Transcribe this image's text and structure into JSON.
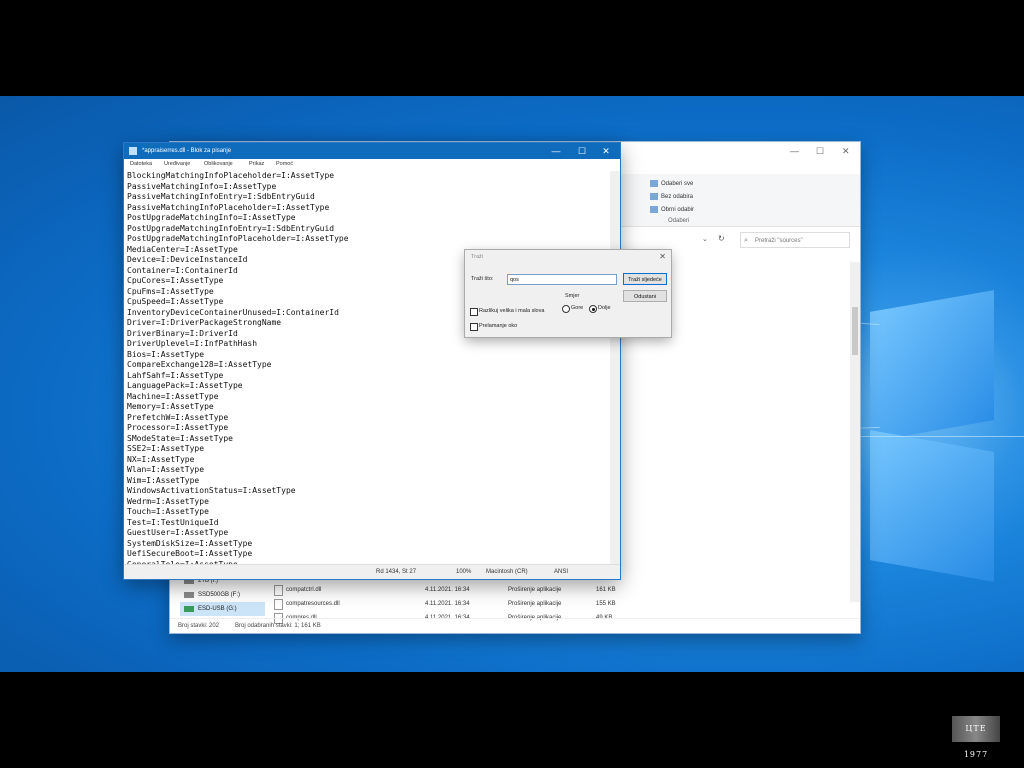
{
  "notepad": {
    "title": "*appraiserres.dll - Blok za pisanje",
    "menu": [
      "Datoteka",
      "Uređivanje",
      "Oblikovanje",
      "Prikaz",
      "Pomoć"
    ],
    "lines": [
      "BlockingMatchingInfoPlaceholder=I:AssetType",
      "PassiveMatchingInfo=I:AssetType",
      "PassiveMatchingInfoEntry=I:SdbEntryGuid",
      "PassiveMatchingInfoPlaceholder=I:AssetType",
      "PostUpgradeMatchingInfo=I:AssetType",
      "PostUpgradeMatchingInfoEntry=I:SdbEntryGuid",
      "PostUpgradeMatchingInfoPlaceholder=I:AssetType",
      "MediaCenter=I:AssetType",
      "Device=I:DeviceInstanceId",
      "Container=I:ContainerId",
      "CpuCores=I:AssetType",
      "CpuFms=I:AssetType",
      "CpuSpeed=I:AssetType",
      "InventoryDeviceContainerUnused=I:ContainerId",
      "Driver=I:DriverPackageStrongName",
      "DriverBinary=I:DriverId",
      "DriverUplevel=I:InfPathHash",
      "Bios=I:AssetType",
      "CompareExchange128=I:AssetType",
      "LahfSahf=I:AssetType",
      "LanguagePack=I:AssetType",
      "Machine=I:AssetType",
      "Memory=I:AssetType",
      "PrefetchW=I:AssetType",
      "Processor=I:AssetType",
      "SModeState=I:AssetType",
      "SSE2=I:AssetType",
      "NX=I:AssetType",
      "Wlan=I:AssetType",
      "Wim=I:AssetType",
      "WindowsActivationStatus=I:AssetType",
      "Wedrm=I:AssetType",
      "Touch=I:AssetType",
      "Test=I:TestUniqueId",
      "GuestUser=I:AssetType",
      "SystemDiskSize=I:AssetType",
      "UefiSecureBoot=I:AssetType",
      "GeneralTele=I:AssetType"
    ],
    "status": {
      "position": "Rd 1434, St 27",
      "zoom": "100%",
      "line_ending": "Macintosh (CR)",
      "encoding": "ANSI"
    },
    "controls": {
      "minimize": "—",
      "maximize": "☐",
      "close": "✕"
    }
  },
  "find_dialog": {
    "title": "Traži",
    "find_label": "Traži što:",
    "find_value": "qos",
    "find_next": "Traži sljedeće",
    "cancel": "Odustani",
    "direction_label": "Smjer",
    "direction_up": "Gore",
    "direction_down": "Dolje",
    "direction_selected": "down",
    "match_case": "Razlikuj velika i mala slova",
    "wrap_around": "Prelamanje oko",
    "close": "✕"
  },
  "explorer": {
    "ribbon": {
      "select_all": "Odaberi sve",
      "select_none": "Bez odabira",
      "invert": "Obrni odabir",
      "group": "Odaberi"
    },
    "search_placeholder": "Pretraži \"sources\"",
    "nav": [
      {
        "label": "2TB (I:)"
      },
      {
        "label": "SSD500GB (F:)"
      },
      {
        "label": "ESD-USB (G:)",
        "selected": true
      }
    ],
    "files": [
      {
        "name": "compatctrl.dll",
        "date": "4.11.2021. 16:34",
        "type": "Proširenje aplikacije",
        "size": "161 KB"
      },
      {
        "name": "compatresources.dll",
        "date": "4.11.2021. 16:34",
        "type": "Proširenje aplikacije",
        "size": "155 KB"
      },
      {
        "name": "compres.dll",
        "date": "4.11.2021. 16:34",
        "type": "Proširenje aplikacije",
        "size": "49 KB"
      }
    ],
    "status_items": "Broj stavki: 202",
    "status_selected": "Broj odabranih stavki: 1; 161 KB"
  },
  "watermark": "ЦТЕ 1977"
}
